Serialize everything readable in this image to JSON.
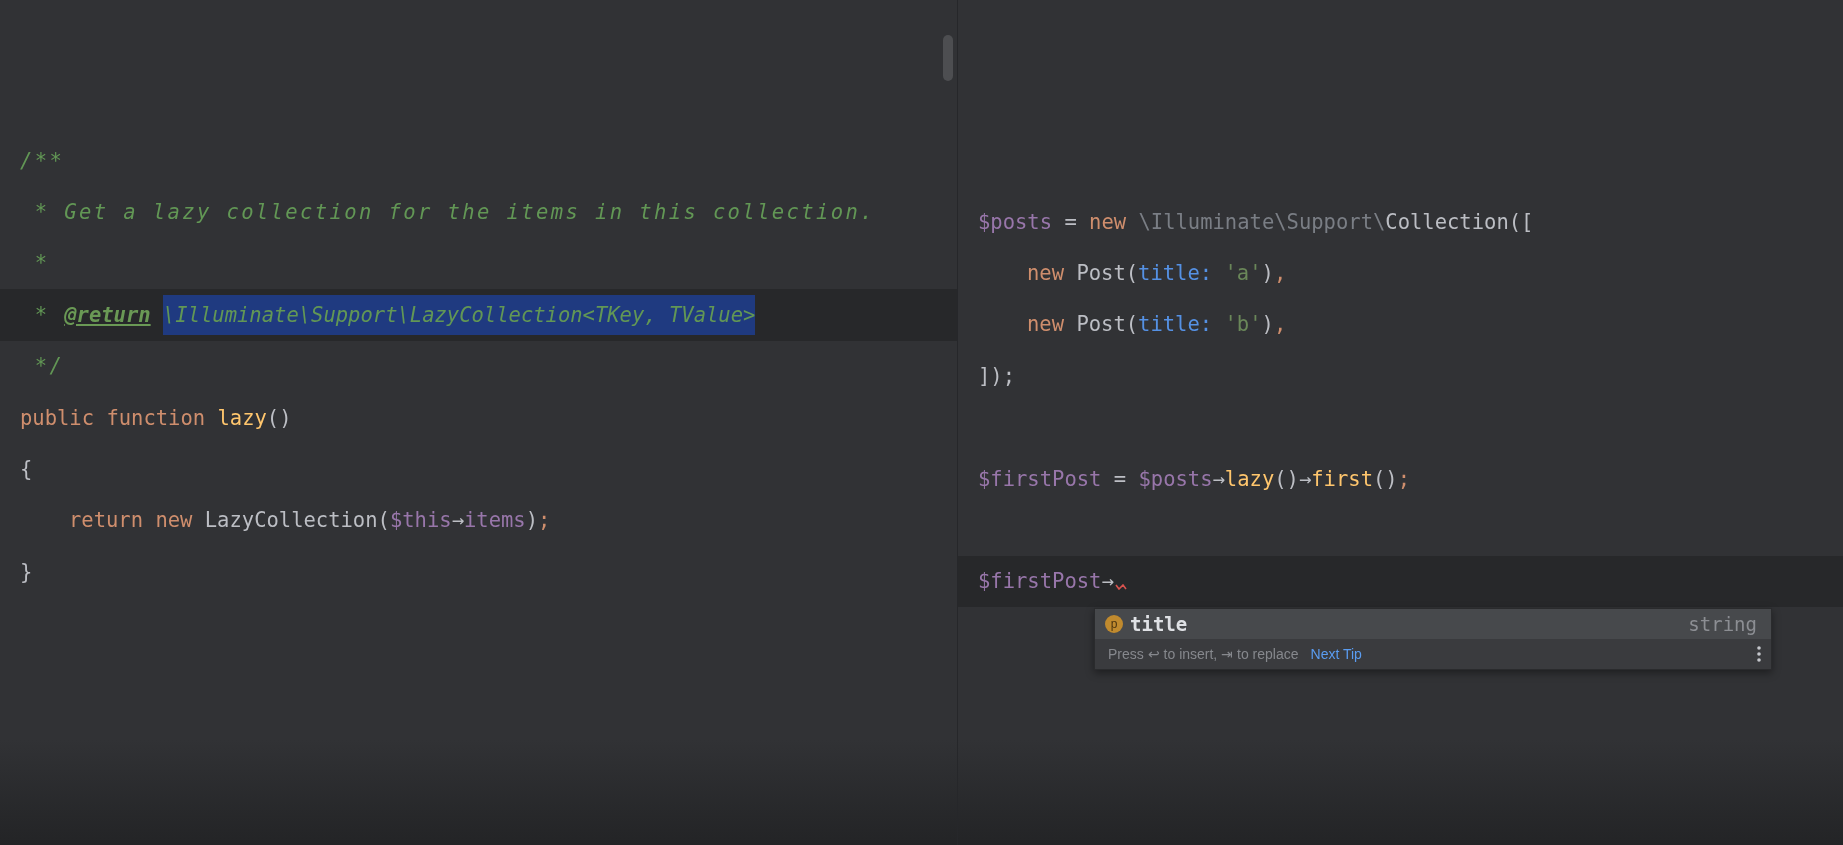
{
  "editors": [
    {
      "scrollbar": true,
      "lines": [
        {
          "tokens": [
            {
              "text": "/**",
              "kind": "doc"
            }
          ]
        },
        {
          "tokens": [
            {
              "text": " * Get a lazy collection for the items in this collection.",
              "kind": "doc"
            }
          ]
        },
        {
          "tokens": [
            {
              "text": " *",
              "kind": "doc"
            }
          ]
        },
        {
          "current": true,
          "tokens": [
            {
              "text": " * ",
              "kind": "doc"
            },
            {
              "text": "@return",
              "kind": "doc-tag"
            },
            {
              "text": "\\Illuminate\\Support\\LazyCollection<TKey, TValue>",
              "kind": "doc",
              "selected": true
            }
          ]
        },
        {
          "tokens": [
            {
              "text": " */",
              "kind": "doc"
            }
          ]
        },
        {
          "tokens": [
            {
              "text": "public function ",
              "kind": "keyword"
            },
            {
              "text": "lazy",
              "kind": "function"
            },
            {
              "text": "()",
              "kind": "plain"
            }
          ]
        },
        {
          "tokens": [
            {
              "text": "{",
              "kind": "plain"
            }
          ]
        },
        {
          "indent": true,
          "tokens": [
            {
              "text": "return new ",
              "kind": "keyword"
            },
            {
              "text": "LazyCollection(",
              "kind": "plain"
            },
            {
              "text": "$this",
              "kind": "variable"
            },
            {
              "text": "→",
              "kind": "plain"
            },
            {
              "text": "items",
              "kind": "variable"
            },
            {
              "text": ")",
              "kind": "plain"
            },
            {
              "text": ";",
              "kind": "keyword"
            }
          ]
        },
        {
          "tokens": [
            {
              "text": "}",
              "kind": "plain"
            }
          ]
        }
      ]
    },
    {
      "lines": [
        {
          "tokens": [
            {
              "text": "$posts",
              "kind": "variable"
            },
            {
              "text": " = ",
              "kind": "plain"
            },
            {
              "text": "new ",
              "kind": "keyword"
            },
            {
              "text": "\\Illuminate\\Support\\",
              "kind": "namespace"
            },
            {
              "text": "Collection([",
              "kind": "plain"
            }
          ]
        },
        {
          "indent": true,
          "tokens": [
            {
              "text": "new ",
              "kind": "keyword"
            },
            {
              "text": "Post(",
              "kind": "plain"
            },
            {
              "text": "title: ",
              "kind": "named-arg"
            },
            {
              "text": "'a'",
              "kind": "string"
            },
            {
              "text": ")",
              "kind": "plain"
            },
            {
              "text": ",",
              "kind": "keyword"
            }
          ]
        },
        {
          "indent": true,
          "tokens": [
            {
              "text": "new ",
              "kind": "keyword"
            },
            {
              "text": "Post(",
              "kind": "plain"
            },
            {
              "text": "title: ",
              "kind": "named-arg"
            },
            {
              "text": "'b'",
              "kind": "string"
            },
            {
              "text": ")",
              "kind": "plain"
            },
            {
              "text": ",",
              "kind": "keyword"
            }
          ]
        },
        {
          "tokens": [
            {
              "text": "]);",
              "kind": "plain"
            }
          ]
        },
        {
          "blank_before": true,
          "tokens": [
            {
              "text": "$firstPost",
              "kind": "variable"
            },
            {
              "text": " = ",
              "kind": "plain"
            },
            {
              "text": "$posts",
              "kind": "variable"
            },
            {
              "text": "→",
              "kind": "plain"
            },
            {
              "text": "lazy",
              "kind": "function"
            },
            {
              "text": "()",
              "kind": "plain"
            },
            {
              "text": "→",
              "kind": "plain"
            },
            {
              "text": "first",
              "kind": "function"
            },
            {
              "text": "()",
              "kind": "plain"
            },
            {
              "text": ";",
              "kind": "keyword"
            }
          ]
        },
        {
          "blank_before": true,
          "current": true,
          "error": true,
          "tokens": [
            {
              "text": "$firstPost",
              "kind": "variable"
            },
            {
              "text": "→",
              "kind": "plain"
            }
          ]
        }
      ],
      "completion": {
        "items": [
          {
            "badge": "p",
            "label": "title",
            "type": "string",
            "selected": true
          }
        ],
        "hint": "Press ↩ to insert, ⇥ to replace",
        "link": "Next Tip"
      }
    }
  ]
}
